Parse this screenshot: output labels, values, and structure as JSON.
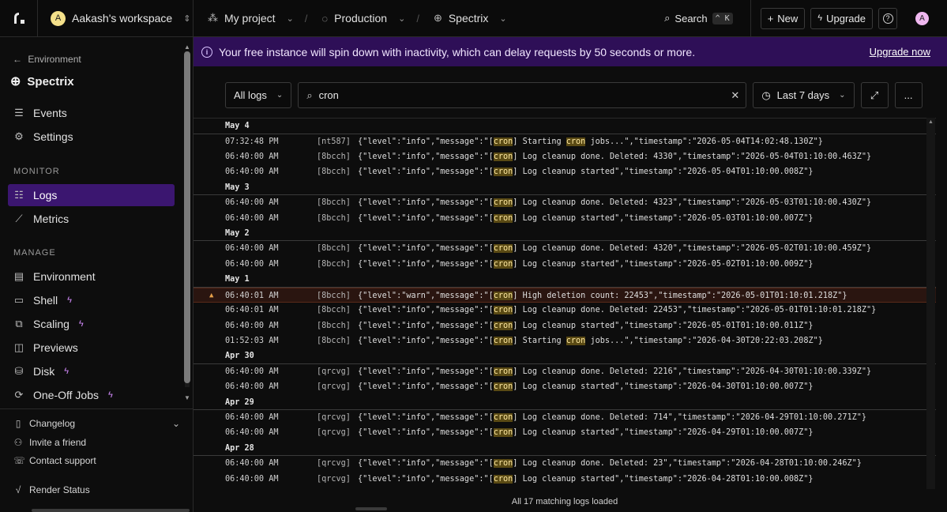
{
  "topbar": {
    "workspace_initial": "A",
    "workspace_name": "Aakash's workspace",
    "project": "My project",
    "environment": "Production",
    "service": "Spectrix",
    "search_label": "Search",
    "search_shortcut": "^ K",
    "new_label": "New",
    "upgrade_label": "Upgrade",
    "avatar_initial": "A"
  },
  "sidebar": {
    "back_label": "Environment",
    "service_name": "Spectrix",
    "top_items": [
      {
        "label": "Events",
        "icon": "list-icon"
      },
      {
        "label": "Settings",
        "icon": "gear-icon"
      }
    ],
    "monitor_heading": "MONITOR",
    "monitor_items": [
      {
        "label": "Logs",
        "icon": "logs-icon",
        "active": true
      },
      {
        "label": "Metrics",
        "icon": "chart-icon"
      }
    ],
    "manage_heading": "MANAGE",
    "manage_items": [
      {
        "label": "Environment",
        "icon": "environment-icon"
      },
      {
        "label": "Shell",
        "icon": "terminal-icon"
      },
      {
        "label": "Scaling",
        "icon": "scaling-icon"
      },
      {
        "label": "Previews",
        "icon": "previews-icon"
      },
      {
        "label": "Disk",
        "icon": "disk-icon"
      },
      {
        "label": "One-Off Jobs",
        "icon": "jobs-icon"
      }
    ],
    "footer_items": [
      {
        "label": "Changelog",
        "icon": "changelog-icon"
      },
      {
        "label": "Invite a friend",
        "icon": "invite-icon"
      },
      {
        "label": "Contact support",
        "icon": "support-icon"
      },
      {
        "label": "Render Status",
        "icon": "status-icon"
      }
    ]
  },
  "banner": {
    "message": "Your free instance will spin down with inactivity, which can delay requests by 50 seconds or more.",
    "link": "Upgrade now"
  },
  "filters": {
    "level": "All logs",
    "search_value": "cron",
    "range": "Last 7 days",
    "more": "..."
  },
  "logs": [
    {
      "date": "May 4",
      "rows": [
        {
          "time": "07:32:48 PM",
          "inst": "[nt587]",
          "level": "info",
          "msg": [
            [
              "{\"level\":\"info\",\"message\":\"[",
              false
            ],
            [
              "cron",
              true
            ],
            [
              "] Starting ",
              false
            ],
            [
              "cron",
              true
            ],
            [
              " jobs...\",\"timestamp\":\"2026-05-04T14:02:48.130Z\"}",
              false
            ]
          ]
        },
        {
          "time": "06:40:00 AM",
          "inst": "[8bcch]",
          "level": "info",
          "msg": [
            [
              "{\"level\":\"info\",\"message\":\"[",
              false
            ],
            [
              "cron",
              true
            ],
            [
              "] Log cleanup done. Deleted: 4330\",\"timestamp\":\"2026-05-04T01:10:00.463Z\"}",
              false
            ]
          ]
        },
        {
          "time": "06:40:00 AM",
          "inst": "[8bcch]",
          "level": "info",
          "msg": [
            [
              "{\"level\":\"info\",\"message\":\"[",
              false
            ],
            [
              "cron",
              true
            ],
            [
              "] Log cleanup started\",\"timestamp\":\"2026-05-04T01:10:00.008Z\"}",
              false
            ]
          ]
        }
      ]
    },
    {
      "date": "May 3",
      "rows": [
        {
          "time": "06:40:00 AM",
          "inst": "[8bcch]",
          "level": "info",
          "msg": [
            [
              "{\"level\":\"info\",\"message\":\"[",
              false
            ],
            [
              "cron",
              true
            ],
            [
              "] Log cleanup done. Deleted: 4323\",\"timestamp\":\"2026-05-03T01:10:00.430Z\"}",
              false
            ]
          ]
        },
        {
          "time": "06:40:00 AM",
          "inst": "[8bcch]",
          "level": "info",
          "msg": [
            [
              "{\"level\":\"info\",\"message\":\"[",
              false
            ],
            [
              "cron",
              true
            ],
            [
              "] Log cleanup started\",\"timestamp\":\"2026-05-03T01:10:00.007Z\"}",
              false
            ]
          ]
        }
      ]
    },
    {
      "date": "May 2",
      "rows": [
        {
          "time": "06:40:00 AM",
          "inst": "[8bcch]",
          "level": "info",
          "msg": [
            [
              "{\"level\":\"info\",\"message\":\"[",
              false
            ],
            [
              "cron",
              true
            ],
            [
              "] Log cleanup done. Deleted: 4320\",\"timestamp\":\"2026-05-02T01:10:00.459Z\"}",
              false
            ]
          ]
        },
        {
          "time": "06:40:00 AM",
          "inst": "[8bcch]",
          "level": "info",
          "msg": [
            [
              "{\"level\":\"info\",\"message\":\"[",
              false
            ],
            [
              "cron",
              true
            ],
            [
              "] Log cleanup started\",\"timestamp\":\"2026-05-02T01:10:00.009Z\"}",
              false
            ]
          ]
        }
      ]
    },
    {
      "date": "May 1",
      "rows": [
        {
          "time": "06:40:01 AM",
          "inst": "[8bcch]",
          "level": "warn",
          "msg": [
            [
              "{\"level\":\"warn\",\"message\":\"[",
              false
            ],
            [
              "cron",
              true
            ],
            [
              "] High deletion count: 22453\",\"timestamp\":\"2026-05-01T01:10:01.218Z\"}",
              false
            ]
          ]
        },
        {
          "time": "06:40:01 AM",
          "inst": "[8bcch]",
          "level": "info",
          "msg": [
            [
              "{\"level\":\"info\",\"message\":\"[",
              false
            ],
            [
              "cron",
              true
            ],
            [
              "] Log cleanup done. Deleted: 22453\",\"timestamp\":\"2026-05-01T01:10:01.218Z\"}",
              false
            ]
          ]
        },
        {
          "time": "06:40:00 AM",
          "inst": "[8bcch]",
          "level": "info",
          "msg": [
            [
              "{\"level\":\"info\",\"message\":\"[",
              false
            ],
            [
              "cron",
              true
            ],
            [
              "] Log cleanup started\",\"timestamp\":\"2026-05-01T01:10:00.011Z\"}",
              false
            ]
          ]
        },
        {
          "time": "01:52:03 AM",
          "inst": "[8bcch]",
          "level": "info",
          "msg": [
            [
              "{\"level\":\"info\",\"message\":\"[",
              false
            ],
            [
              "cron",
              true
            ],
            [
              "] Starting ",
              false
            ],
            [
              "cron",
              true
            ],
            [
              " jobs...\",\"timestamp\":\"2026-04-30T20:22:03.208Z\"}",
              false
            ]
          ]
        }
      ]
    },
    {
      "date": "Apr 30",
      "rows": [
        {
          "time": "06:40:00 AM",
          "inst": "[qrcvg]",
          "level": "info",
          "msg": [
            [
              "{\"level\":\"info\",\"message\":\"[",
              false
            ],
            [
              "cron",
              true
            ],
            [
              "] Log cleanup done. Deleted: 2216\",\"timestamp\":\"2026-04-30T01:10:00.339Z\"}",
              false
            ]
          ]
        },
        {
          "time": "06:40:00 AM",
          "inst": "[qrcvg]",
          "level": "info",
          "msg": [
            [
              "{\"level\":\"info\",\"message\":\"[",
              false
            ],
            [
              "cron",
              true
            ],
            [
              "] Log cleanup started\",\"timestamp\":\"2026-04-30T01:10:00.007Z\"}",
              false
            ]
          ]
        }
      ]
    },
    {
      "date": "Apr 29",
      "rows": [
        {
          "time": "06:40:00 AM",
          "inst": "[qrcvg]",
          "level": "info",
          "msg": [
            [
              "{\"level\":\"info\",\"message\":\"[",
              false
            ],
            [
              "cron",
              true
            ],
            [
              "] Log cleanup done. Deleted: 714\",\"timestamp\":\"2026-04-29T01:10:00.271Z\"}",
              false
            ]
          ]
        },
        {
          "time": "06:40:00 AM",
          "inst": "[qrcvg]",
          "level": "info",
          "msg": [
            [
              "{\"level\":\"info\",\"message\":\"[",
              false
            ],
            [
              "cron",
              true
            ],
            [
              "] Log cleanup started\",\"timestamp\":\"2026-04-29T01:10:00.007Z\"}",
              false
            ]
          ]
        }
      ]
    },
    {
      "date": "Apr 28",
      "rows": [
        {
          "time": "06:40:00 AM",
          "inst": "[qrcvg]",
          "level": "info",
          "msg": [
            [
              "{\"level\":\"info\",\"message\":\"[",
              false
            ],
            [
              "cron",
              true
            ],
            [
              "] Log cleanup done. Deleted: 23\",\"timestamp\":\"2026-04-28T01:10:00.246Z\"}",
              false
            ]
          ]
        },
        {
          "time": "06:40:00 AM",
          "inst": "[qrcvg]",
          "level": "info",
          "msg": [
            [
              "{\"level\":\"info\",\"message\":\"[",
              false
            ],
            [
              "cron",
              true
            ],
            [
              "] Log cleanup started\",\"timestamp\":\"2026-04-28T01:10:00.008Z\"}",
              false
            ]
          ]
        }
      ]
    }
  ],
  "status": "All 17 matching logs loaded",
  "colors": {
    "accent": "#3b1670",
    "banner_bg": "#2e0f57",
    "highlight": "#5a4a14",
    "warn": "#e5a04a"
  }
}
